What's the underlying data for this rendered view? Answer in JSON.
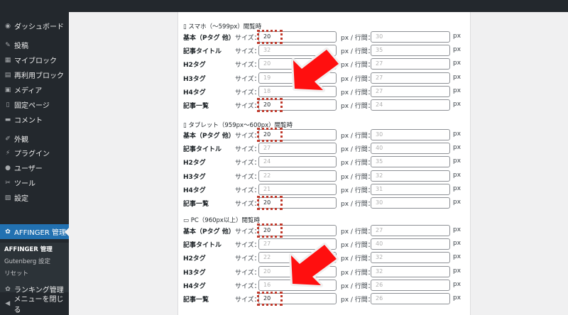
{
  "sidebar": {
    "items": [
      {
        "icon": "dashboard-icon",
        "glyph": "◉",
        "label": "ダッシュボード"
      },
      {
        "icon": "pin-icon",
        "glyph": "✎",
        "label": "投稿"
      },
      {
        "icon": "block-icon",
        "glyph": "▦",
        "label": "マイブロック"
      },
      {
        "icon": "reusable-block-icon",
        "glyph": "▤",
        "label": "再利用ブロック"
      },
      {
        "icon": "media-icon",
        "glyph": "▣",
        "label": "メディア"
      },
      {
        "icon": "page-icon",
        "glyph": "▯",
        "label": "固定ページ"
      },
      {
        "icon": "comment-icon",
        "glyph": "▬",
        "label": "コメント"
      },
      {
        "icon": "appearance-icon",
        "glyph": "✐",
        "label": "外観"
      },
      {
        "icon": "plugin-icon",
        "glyph": "⚡",
        "label": "プラグイン"
      },
      {
        "icon": "user-icon",
        "glyph": "●",
        "label": "ユーザー"
      },
      {
        "icon": "tool-icon",
        "glyph": "✂",
        "label": "ツール"
      },
      {
        "icon": "settings-icon",
        "glyph": "▨",
        "label": "設定"
      },
      {
        "icon": "gear-icon",
        "glyph": "✿",
        "label": "AFFINGER 管理"
      },
      {
        "icon": "ranking-gear-icon",
        "glyph": "✿",
        "label": "ランキング管理"
      },
      {
        "icon": "collapse-icon",
        "glyph": "◀",
        "label": "メニューを閉じる"
      }
    ],
    "submenu": [
      "AFFINGER 管理",
      "Gutenberg 設定",
      "リセット"
    ]
  },
  "labels": {
    "size": "サイズ：",
    "px_lh": "px / 行間：",
    "px": "px"
  },
  "sections": [
    {
      "heading": "▯ スマホ（～599px）閲覧時",
      "rows": [
        {
          "label": "基本（Pタグ 他）",
          "size": "20",
          "line": "30",
          "hl": true
        },
        {
          "label": "記事タイトル",
          "size": "32",
          "line": "35",
          "hl": false
        },
        {
          "label": "H2タグ",
          "size": "20",
          "line": "27",
          "hl": false
        },
        {
          "label": "H3タグ",
          "size": "19",
          "line": "27",
          "hl": false
        },
        {
          "label": "H4タグ",
          "size": "18",
          "line": "27",
          "hl": false
        },
        {
          "label": "記事一覧",
          "size": "20",
          "line": "24",
          "hl": true
        }
      ]
    },
    {
      "heading": "▯ タブレット（959px～600px）閲覧時",
      "rows": [
        {
          "label": "基本（Pタグ 他）",
          "size": "20",
          "line": "30",
          "hl": true
        },
        {
          "label": "記事タイトル",
          "size": "27",
          "line": "40",
          "hl": false
        },
        {
          "label": "H2タグ",
          "size": "24",
          "line": "35",
          "hl": false
        },
        {
          "label": "H3タグ",
          "size": "22",
          "line": "32",
          "hl": false
        },
        {
          "label": "H4タグ",
          "size": "21",
          "line": "31",
          "hl": false
        },
        {
          "label": "記事一覧",
          "size": "20",
          "line": "30",
          "hl": true
        }
      ]
    },
    {
      "heading": "▭ PC（960px以上）閲覧時",
      "rows": [
        {
          "label": "基本（Pタグ 他）",
          "size": "20",
          "line": "27",
          "hl": true
        },
        {
          "label": "記事タイトル",
          "size": "27",
          "line": "40",
          "hl": false
        },
        {
          "label": "H2タグ",
          "size": "22",
          "line": "32",
          "hl": false
        },
        {
          "label": "H3タグ",
          "size": "20",
          "line": "32",
          "hl": false
        },
        {
          "label": "H4タグ",
          "size": "16",
          "line": "26",
          "hl": false
        },
        {
          "label": "記事一覧",
          "size": "20",
          "line": "26",
          "hl": true
        }
      ]
    }
  ]
}
